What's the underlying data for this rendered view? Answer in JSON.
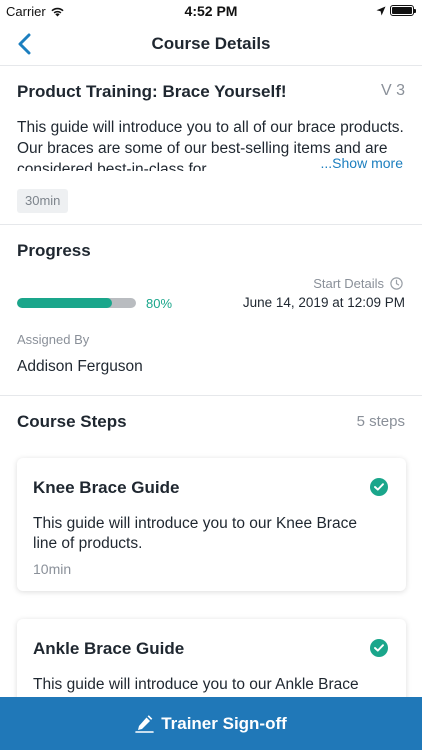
{
  "status_bar": {
    "carrier": "Carrier",
    "time": "4:52 PM"
  },
  "nav": {
    "title": "Course Details",
    "back_icon": "chevron-left-icon"
  },
  "course": {
    "title": "Product Training: Brace Yourself!",
    "version": "V 3",
    "description": "This guide will introduce you to all of our brace products. Our braces are some of our best-selling items and are considered best-in-class for",
    "show_more": "...Show more",
    "duration": "30min"
  },
  "progress": {
    "heading": "Progress",
    "percent_label": "80%",
    "percent_value": 0.8,
    "start_details_label": "Start Details",
    "start_date": "June 14, 2019 at 12:09 PM",
    "assigned_by_label": "Assigned By",
    "assigned_by_name": "Addison Ferguson"
  },
  "steps": {
    "heading": "Course Steps",
    "count_label": "5 steps",
    "items": [
      {
        "title": "Knee Brace Guide",
        "description": "This guide will introduce you to our Knee Brace line of products.",
        "duration": "10min",
        "completed": true
      },
      {
        "title": "Ankle Brace Guide",
        "description": "This guide will introduce you to our Ankle Brace",
        "duration": "",
        "completed": true
      }
    ]
  },
  "footer": {
    "button_label": "Trainer Sign-off",
    "icon": "pen-sign-icon"
  },
  "colors": {
    "accent_blue": "#2078b8",
    "link_blue": "#1c7fbf",
    "success_green": "#1aa68b"
  }
}
